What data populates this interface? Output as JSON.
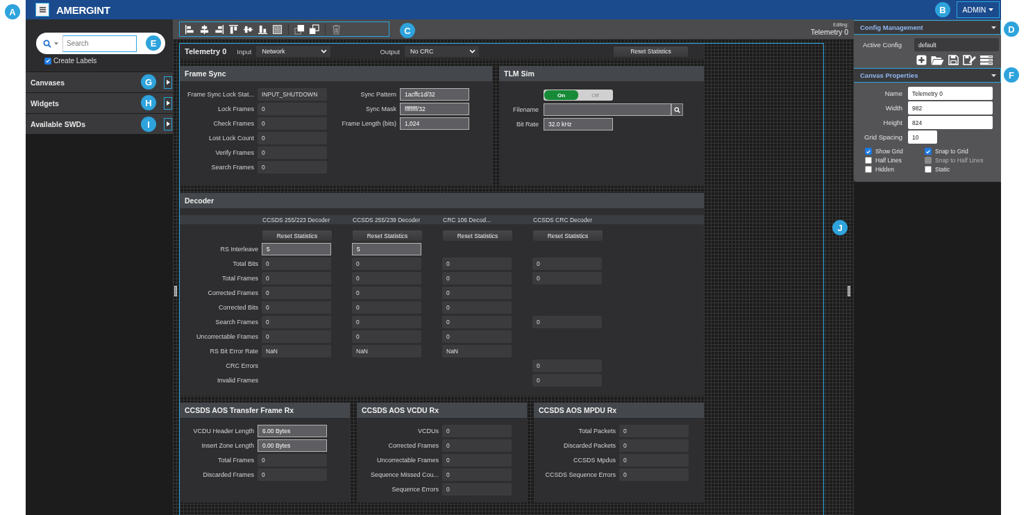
{
  "callouts": [
    {
      "label": "A"
    },
    {
      "label": "B"
    },
    {
      "label": "C"
    },
    {
      "label": "D"
    },
    {
      "label": "E"
    },
    {
      "label": "F"
    },
    {
      "label": "G"
    },
    {
      "label": "H"
    },
    {
      "label": "I"
    },
    {
      "label": "J"
    }
  ],
  "header": {
    "logo": "AMERGINT",
    "user_menu": "ADMIN"
  },
  "sidebar": {
    "search": {
      "placeholder": "Search"
    },
    "create_labels": {
      "label": "Create Labels",
      "checked": true
    },
    "sections": [
      {
        "label": "Canvases",
        "expanded": false
      },
      {
        "label": "Widgets",
        "expanded": false
      },
      {
        "label": "Available SWDs",
        "expanded": false
      }
    ]
  },
  "toolbar": {
    "editing_label": "Editing:",
    "editing_value": "Telemetry 0"
  },
  "widget": {
    "title": "Telemetry 0",
    "input": {
      "label": "Input",
      "value": "Network"
    },
    "output": {
      "label": "Output",
      "value": "No CRC"
    },
    "reset_button": "Reset Statistics",
    "frame_sync": {
      "title": "Frame Sync",
      "left": [
        {
          "label": "Frame Sync Lock Stat...",
          "value": "INPUT_SHUTDOWN",
          "editable": false
        },
        {
          "label": "Lock Frames",
          "value": "0",
          "editable": false
        },
        {
          "label": "Check Frames",
          "value": "0",
          "editable": false
        },
        {
          "label": "Lost Lock Count",
          "value": "0",
          "editable": false
        },
        {
          "label": "Verify Frames",
          "value": "0",
          "editable": false
        },
        {
          "label": "Search Frames",
          "value": "0",
          "editable": false
        }
      ],
      "right": [
        {
          "label": "Sync Pattern",
          "value": "1acffc1d/32",
          "editable": true
        },
        {
          "label": "Sync Mask",
          "value": "ffffffff/32",
          "editable": true
        },
        {
          "label": "Frame Length (bits)",
          "value": "1,024",
          "editable": true
        }
      ]
    },
    "tlm_sim": {
      "title": "TLM Sim",
      "toggle": {
        "on_label": "On",
        "off_label": "Off",
        "on": true
      },
      "filename": {
        "label": "Filename"
      },
      "bit_rate": {
        "label": "Bit Rate",
        "value": "32.0 kHz",
        "editable": true
      }
    },
    "decoder": {
      "title": "Decoder",
      "columns": [
        {
          "name": "CCSDS 255/223 Decoder",
          "button": "Reset Statistics"
        },
        {
          "name": "CCSDS 255/239 Decoder",
          "button": "Reset Statistics"
        },
        {
          "name": "CRC 106 Decod...",
          "button": "Reset Statistics"
        },
        {
          "name": "CCSDS CRC Decoder",
          "button": "Reset Statistics"
        }
      ],
      "rows": [
        {
          "label": "RS Interleave",
          "cells": [
            {
              "value": "5",
              "editable": true
            },
            {
              "value": "5",
              "editable": true
            },
            null,
            null
          ]
        },
        {
          "label": "Total Bits",
          "cells": [
            {
              "value": "0",
              "editable": false
            },
            {
              "value": "0",
              "editable": false
            },
            {
              "value": "0",
              "editable": false
            },
            {
              "value": "0",
              "editable": false
            }
          ]
        },
        {
          "label": "Total Frames",
          "cells": [
            {
              "value": "0",
              "editable": false
            },
            {
              "value": "0",
              "editable": false
            },
            {
              "value": "0",
              "editable": false
            },
            {
              "value": "0",
              "editable": false
            }
          ]
        },
        {
          "label": "Corrected Frames",
          "cells": [
            {
              "value": "0",
              "editable": false
            },
            {
              "value": "0",
              "editable": false
            },
            {
              "value": "0",
              "editable": false
            },
            null
          ]
        },
        {
          "label": "Corrected Bits",
          "cells": [
            {
              "value": "0",
              "editable": false
            },
            {
              "value": "0",
              "editable": false
            },
            {
              "value": "0",
              "editable": false
            },
            null
          ]
        },
        {
          "label": "Search Frames",
          "cells": [
            {
              "value": "0",
              "editable": false
            },
            {
              "value": "0",
              "editable": false
            },
            {
              "value": "0",
              "editable": false
            },
            {
              "value": "0",
              "editable": false
            }
          ]
        },
        {
          "label": "Uncorrectable Frames",
          "cells": [
            {
              "value": "0",
              "editable": false
            },
            {
              "value": "0",
              "editable": false
            },
            {
              "value": "0",
              "editable": false
            },
            null
          ]
        },
        {
          "label": "RS Bit Error Rate",
          "cells": [
            {
              "value": "NaN",
              "editable": false
            },
            {
              "value": "NaN",
              "editable": false
            },
            {
              "value": "NaN",
              "editable": false
            },
            null
          ]
        },
        {
          "label": "CRC Errors",
          "cells": [
            null,
            null,
            null,
            {
              "value": "0",
              "editable": false
            }
          ]
        },
        {
          "label": "Invalid Frames",
          "cells": [
            null,
            null,
            null,
            {
              "value": "0",
              "editable": false
            }
          ]
        }
      ]
    },
    "bottom_panels": [
      {
        "title": "CCSDS AOS Transfer Frame Rx",
        "rows": [
          {
            "label": "VCDU Header Length",
            "value": "6.00 Bytes",
            "editable": true
          },
          {
            "label": "Insert Zone Length",
            "value": "0.00 Bytes",
            "editable": true
          },
          {
            "label": "Total Frames",
            "value": "0",
            "editable": false
          },
          {
            "label": "Discarded Frames",
            "value": "0",
            "editable": false
          }
        ]
      },
      {
        "title": "CCSDS AOS VCDU Rx",
        "rows": [
          {
            "label": "VCDUs",
            "value": "0",
            "editable": false
          },
          {
            "label": "Corrected Frames",
            "value": "0",
            "editable": false
          },
          {
            "label": "Uncorrectable Frames",
            "value": "0",
            "editable": false
          },
          {
            "label": "Sequence Missed Cou...",
            "value": "0",
            "editable": false
          },
          {
            "label": "Sequence Errors",
            "value": "0",
            "editable": false
          }
        ]
      },
      {
        "title": "CCSDS AOS MPDU Rx",
        "rows": [
          {
            "label": "Total Packets",
            "value": "0",
            "editable": false
          },
          {
            "label": "Discarded Packets",
            "value": "0",
            "editable": false
          },
          {
            "label": "CCSDS Mpdus",
            "value": "0",
            "editable": false
          },
          {
            "label": "CCSDS Sequence Errors",
            "value": "0",
            "editable": false
          }
        ]
      }
    ]
  },
  "right_panel": {
    "config": {
      "title": "Config Management",
      "expanded": true,
      "active_label": "Active Config",
      "active_value": "default"
    },
    "canvas_properties": {
      "title": "Canvas Properties",
      "expanded": true,
      "fields": [
        {
          "label": "Name",
          "value": "Telemetry 0"
        },
        {
          "label": "Width",
          "value": "982"
        },
        {
          "label": "Height",
          "value": "824"
        }
      ],
      "grid_spacing": {
        "label": "Grid Spacing",
        "value": "10"
      },
      "checkboxes": [
        {
          "label": "Show Grid",
          "checked": true,
          "disabled": false
        },
        {
          "label": "Snap to Grid",
          "checked": true,
          "disabled": false
        },
        {
          "label": "Half Lines",
          "checked": false,
          "disabled": false
        },
        {
          "label": "Snap to Half Lines",
          "checked": false,
          "disabled": true
        },
        {
          "label": "Hidden",
          "checked": false,
          "disabled": false
        },
        {
          "label": "Static",
          "checked": false,
          "disabled": false
        }
      ]
    }
  }
}
